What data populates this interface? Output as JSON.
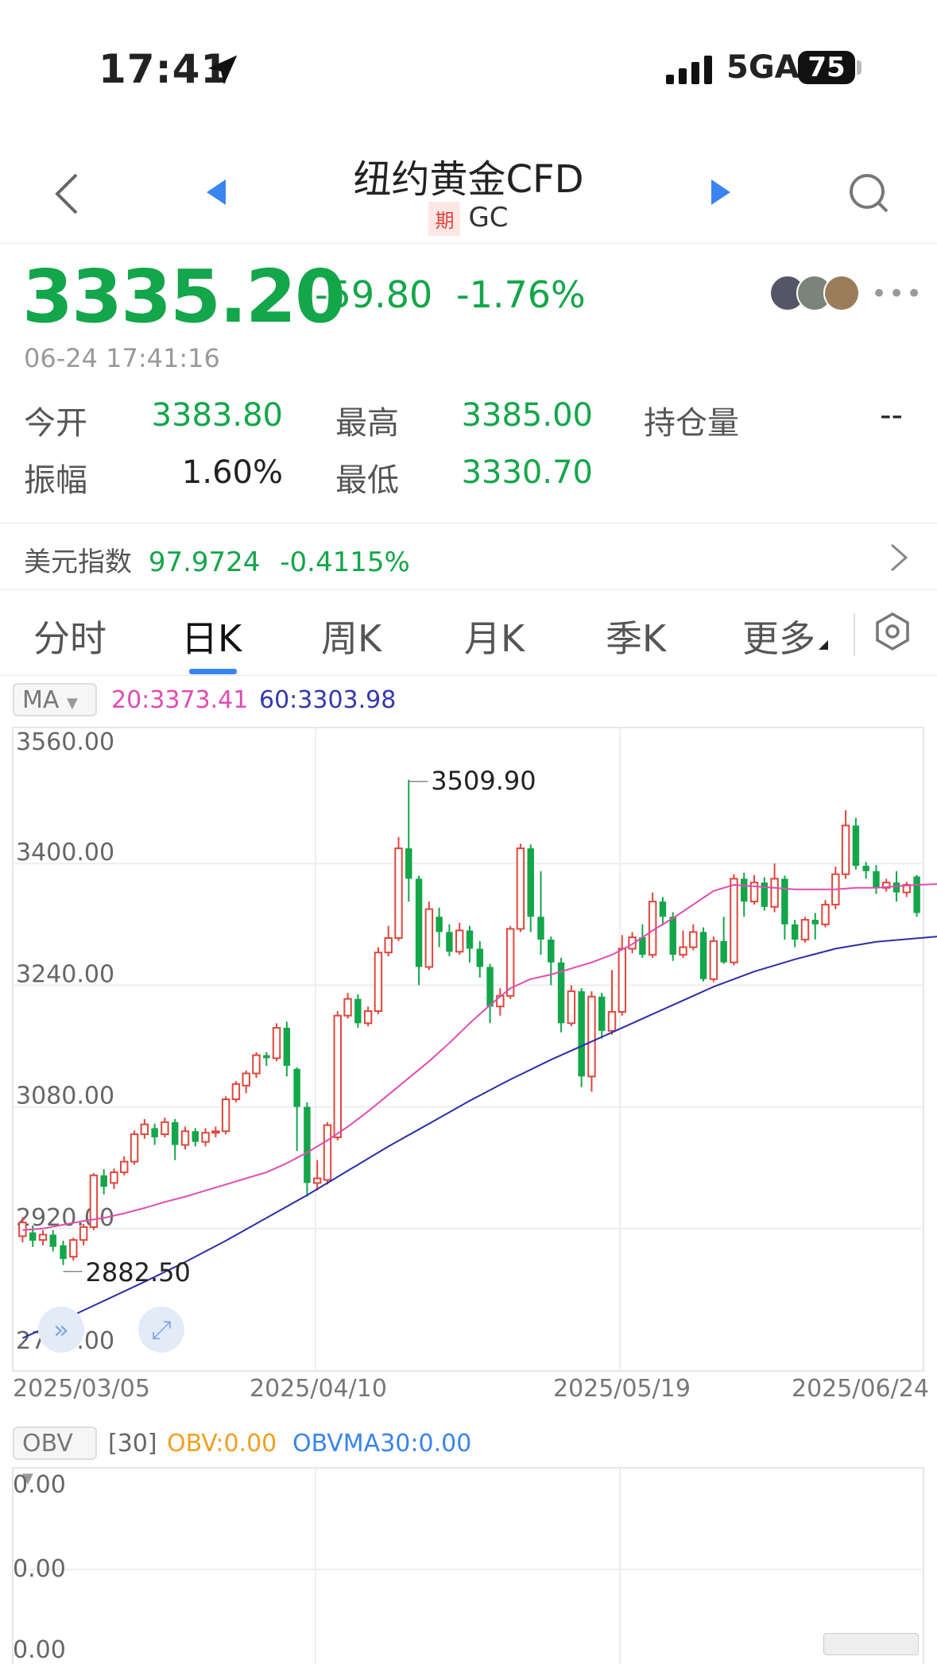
{
  "status": {
    "time": "17:41",
    "network": "5GA",
    "battery": "75"
  },
  "header": {
    "title": "纽约黄金CFD",
    "badge": "期",
    "code": "GC"
  },
  "quote": {
    "price": "3335.20",
    "change": "-59.80",
    "change_pct": "-1.76%",
    "datetime": "06-24 17:41:16"
  },
  "stats": {
    "open_label": "今开",
    "open": "3383.80",
    "high_label": "最高",
    "high": "3385.00",
    "oi_label": "持仓量",
    "oi": "--",
    "amp_label": "振幅",
    "amp": "1.60%",
    "low_label": "最低",
    "low": "3330.70"
  },
  "index": {
    "label": "美元指数",
    "value": "97.9724",
    "pct": "-0.4115%"
  },
  "tabs": [
    "分时",
    "日K",
    "周K",
    "月K",
    "季K",
    "更多"
  ],
  "active_tab": "日K",
  "ma_legend": {
    "button": "MA",
    "ma20": "20:3373.41",
    "ma60": "60:3303.98"
  },
  "obv_legend": {
    "button": "OBV",
    "period": "[30]",
    "obv": "OBV:0.00",
    "obvma": "OBVMA30:0.00"
  },
  "obv_axis": [
    "0.00",
    "0.00",
    "0.00"
  ],
  "colors": {
    "up": "#e0463d",
    "down": "#13a64a",
    "ma20": "#e04cb2",
    "ma60": "#2c2fa8",
    "accent": "#3a84f0"
  },
  "chart_data": {
    "type": "candlestick",
    "y_ticks": [
      "3560.00",
      "3400.00",
      "3240.00",
      "3080.00",
      "2920.00",
      "2760.00"
    ],
    "ylim": [
      2760,
      3560
    ],
    "x_ticks": [
      "2025/03/05",
      "2025/04/10",
      "2025/05/19",
      "2025/06/24"
    ],
    "annotations": {
      "max_label": "3509.90",
      "min_label": "2882.50"
    },
    "candles": [
      [
        2910,
        2928,
        2902,
        2935
      ],
      [
        2915,
        2904,
        2896,
        2924
      ],
      [
        2905,
        2912,
        2898,
        2918
      ],
      [
        2912,
        2896,
        2890,
        2918
      ],
      [
        2898,
        2880,
        2872,
        2904
      ],
      [
        2883,
        2905,
        2878,
        2908
      ],
      [
        2905,
        2922,
        2898,
        2926
      ],
      [
        2922,
        2990,
        2918,
        2993
      ],
      [
        2990,
        2975,
        2965,
        2998
      ],
      [
        2980,
        2994,
        2972,
        2999
      ],
      [
        2994,
        3008,
        2990,
        3015
      ],
      [
        3008,
        3044,
        3004,
        3049
      ],
      [
        3044,
        3057,
        3038,
        3064
      ],
      [
        3052,
        3040,
        3030,
        3058
      ],
      [
        3044,
        3060,
        3040,
        3066
      ],
      [
        3060,
        3030,
        3010,
        3064
      ],
      [
        3030,
        3048,
        3024,
        3054
      ],
      [
        3048,
        3034,
        3028,
        3052
      ],
      [
        3034,
        3046,
        3028,
        3052
      ],
      [
        3046,
        3048,
        3040,
        3054
      ],
      [
        3048,
        3090,
        3044,
        3094
      ],
      [
        3090,
        3110,
        3086,
        3114
      ],
      [
        3108,
        3124,
        3098,
        3128
      ],
      [
        3124,
        3148,
        3118,
        3152
      ],
      [
        3148,
        3144,
        3134,
        3152
      ],
      [
        3144,
        3184,
        3140,
        3190
      ],
      [
        3184,
        3134,
        3120,
        3192
      ],
      [
        3130,
        3080,
        3022,
        3132
      ],
      [
        3080,
        2980,
        2962,
        3086
      ],
      [
        2980,
        2986,
        2970,
        3010
      ],
      [
        2984,
        3056,
        2978,
        3060
      ],
      [
        3040,
        3200,
        3036,
        3206
      ],
      [
        3200,
        3222,
        3196,
        3230
      ],
      [
        3222,
        3190,
        3184,
        3228
      ],
      [
        3190,
        3206,
        3186,
        3212
      ],
      [
        3206,
        3283,
        3202,
        3290
      ],
      [
        3283,
        3302,
        3278,
        3318
      ],
      [
        3302,
        3420,
        3298,
        3435
      ],
      [
        3420,
        3380,
        3350,
        3510
      ],
      [
        3380,
        3264,
        3240,
        3384
      ],
      [
        3264,
        3340,
        3260,
        3350
      ],
      [
        3330,
        3310,
        3290,
        3342
      ],
      [
        3310,
        3284,
        3278,
        3320
      ],
      [
        3284,
        3312,
        3280,
        3322
      ],
      [
        3312,
        3288,
        3270,
        3318
      ],
      [
        3288,
        3264,
        3250,
        3298
      ],
      [
        3264,
        3212,
        3190,
        3268
      ],
      [
        3212,
        3226,
        3200,
        3236
      ],
      [
        3226,
        3314,
        3222,
        3318
      ],
      [
        3314,
        3420,
        3310,
        3426
      ],
      [
        3420,
        3330,
        3310,
        3425
      ],
      [
        3330,
        3300,
        3280,
        3390
      ],
      [
        3300,
        3270,
        3240,
        3304
      ],
      [
        3270,
        3190,
        3178,
        3276
      ],
      [
        3190,
        3232,
        3186,
        3240
      ],
      [
        3232,
        3120,
        3106,
        3236
      ],
      [
        3120,
        3225,
        3100,
        3232
      ],
      [
        3225,
        3180,
        3170,
        3230
      ],
      [
        3180,
        3205,
        3175,
        3260
      ],
      [
        3205,
        3288,
        3200,
        3306
      ],
      [
        3288,
        3303,
        3282,
        3310
      ],
      [
        3303,
        3280,
        3276,
        3320
      ],
      [
        3280,
        3350,
        3276,
        3362
      ],
      [
        3350,
        3330,
        3320,
        3356
      ],
      [
        3330,
        3280,
        3272,
        3336
      ],
      [
        3280,
        3290,
        3276,
        3312
      ],
      [
        3290,
        3310,
        3286,
        3320
      ],
      [
        3310,
        3248,
        3245,
        3316
      ],
      [
        3248,
        3298,
        3244,
        3304
      ],
      [
        3298,
        3270,
        3268,
        3330
      ],
      [
        3270,
        3380,
        3266,
        3386
      ],
      [
        3380,
        3350,
        3330,
        3388
      ],
      [
        3350,
        3375,
        3346,
        3385
      ],
      [
        3375,
        3343,
        3338,
        3382
      ],
      [
        3343,
        3380,
        3336,
        3400
      ],
      [
        3380,
        3320,
        3300,
        3384
      ],
      [
        3320,
        3300,
        3290,
        3326
      ],
      [
        3300,
        3326,
        3296,
        3330
      ],
      [
        3326,
        3320,
        3300,
        3335
      ],
      [
        3320,
        3346,
        3316,
        3352
      ],
      [
        3346,
        3386,
        3340,
        3396
      ],
      [
        3386,
        3450,
        3380,
        3470
      ],
      [
        3450,
        3397,
        3392,
        3460
      ],
      [
        3397,
        3390,
        3380,
        3402
      ],
      [
        3390,
        3368,
        3360,
        3398
      ],
      [
        3368,
        3375,
        3363,
        3380
      ],
      [
        3375,
        3362,
        3350,
        3390
      ],
      [
        3362,
        3372,
        3356,
        3376
      ],
      [
        3383,
        3335,
        3330,
        3385
      ]
    ],
    "ma20": [
      2918,
      2920,
      2925,
      2930,
      2934,
      2940,
      2947,
      2955,
      2962,
      2970,
      2978,
      2986,
      2994,
      3006,
      3020,
      3036,
      3054,
      3074,
      3096,
      3118,
      3140,
      3164,
      3190,
      3214,
      3236,
      3248,
      3254,
      3262,
      3270,
      3280,
      3294,
      3312,
      3328,
      3346,
      3364,
      3372,
      3370,
      3368,
      3366,
      3366,
      3366,
      3368,
      3368,
      3370,
      3372,
      3373
    ],
    "ma20_x": [
      0,
      2,
      4,
      6,
      8,
      10,
      12,
      14,
      16,
      18,
      20,
      22,
      24,
      26,
      28,
      30,
      32,
      34,
      36,
      38,
      40,
      42,
      44,
      46,
      48,
      50,
      52,
      54,
      56,
      58,
      60,
      62,
      64,
      66,
      68,
      70,
      72,
      74,
      76,
      78,
      80,
      82,
      84,
      86,
      88,
      90
    ],
    "ma60": [
      2776,
      2800,
      2825,
      2850,
      2876,
      2904,
      2934,
      2964,
      2996,
      3028,
      3058,
      3088,
      3116,
      3142,
      3166,
      3190,
      3214,
      3238,
      3258,
      3274,
      3288,
      3297,
      3304
    ],
    "ma60_x": [
      0,
      4,
      8,
      12,
      16,
      20,
      24,
      28,
      32,
      36,
      40,
      44,
      48,
      52,
      56,
      60,
      64,
      68,
      72,
      76,
      80,
      84,
      90
    ]
  }
}
